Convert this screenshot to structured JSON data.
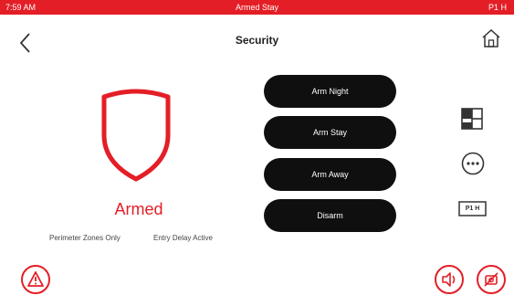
{
  "status_bar": {
    "time": "7:59 AM",
    "state": "Armed Stay",
    "user": "P1 H"
  },
  "header": {
    "title": "Security"
  },
  "security": {
    "status": "Armed",
    "detail_left": "Perimeter Zones Only",
    "detail_right": "Entry Delay Active"
  },
  "arm_buttons": [
    "Arm Night",
    "Arm Stay",
    "Arm Away",
    "Disarm"
  ],
  "side_panel": {
    "partition_label": "P1 H"
  },
  "icons": {
    "back": "chevron-left-icon",
    "home": "home-icon",
    "layout": "grid-layout-icon",
    "more": "more-dots-icon",
    "partition": "partition-badge-icon",
    "alert": "warning-triangle-icon",
    "volume": "speaker-icon",
    "camera": "camera-off-icon"
  },
  "colors": {
    "accent": "#e41e26",
    "button_bg": "#0f0f0f",
    "background": "#ffffff"
  }
}
